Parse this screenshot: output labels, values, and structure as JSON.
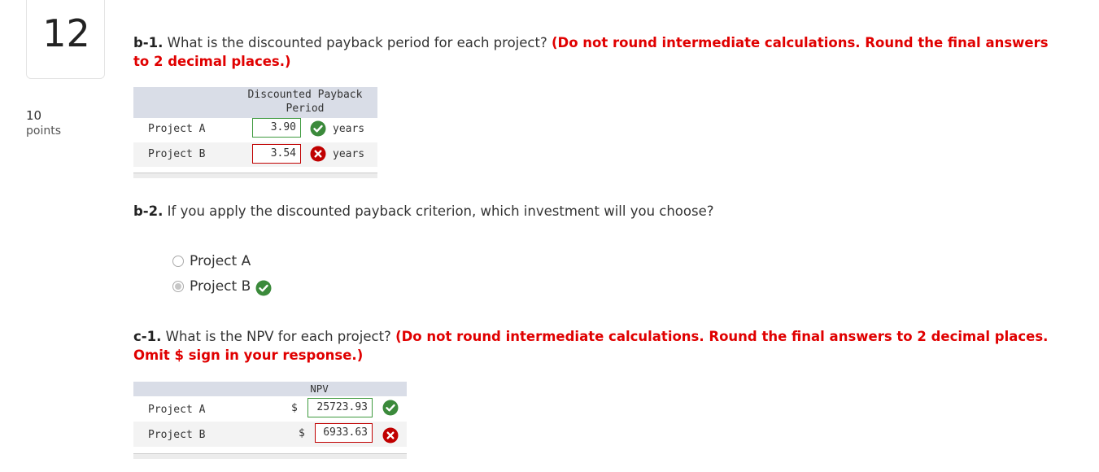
{
  "question": {
    "number": "12",
    "points_value": "10",
    "points_label": "points"
  },
  "b1": {
    "label": "b-1.",
    "text": "What is the discounted payback period for each project?",
    "note": "(Do not round intermediate calculations. Round the final answers to 2 decimal places.)",
    "table": {
      "header_line1": "Discounted Payback",
      "header_line2": "Period",
      "rows": [
        {
          "label": "Project A",
          "value": "3.90",
          "unit": "years",
          "status": "correct"
        },
        {
          "label": "Project B",
          "value": "3.54",
          "unit": "years",
          "status": "incorrect"
        }
      ]
    }
  },
  "b2": {
    "label": "b-2.",
    "text": "If you apply the discounted payback criterion, which investment will you choose?",
    "options": [
      {
        "label": "Project A",
        "selected": false
      },
      {
        "label": "Project B",
        "selected": true,
        "status": "correct"
      }
    ]
  },
  "c1": {
    "label": "c-1.",
    "text": "What is the NPV for each project?",
    "note": "(Do not round intermediate calculations. Round the final answers to 2 decimal places. Omit $ sign in your response.)",
    "table": {
      "header": "NPV",
      "currency": "$",
      "rows": [
        {
          "label": "Project A",
          "value": "25723.93",
          "status": "correct"
        },
        {
          "label": "Project B",
          "value": "6933.63",
          "status": "incorrect"
        }
      ]
    }
  },
  "colors": {
    "correct": "#3b8a3b",
    "incorrect": "#c00000",
    "note": "#e00000",
    "header_bg": "#d9dde7"
  }
}
